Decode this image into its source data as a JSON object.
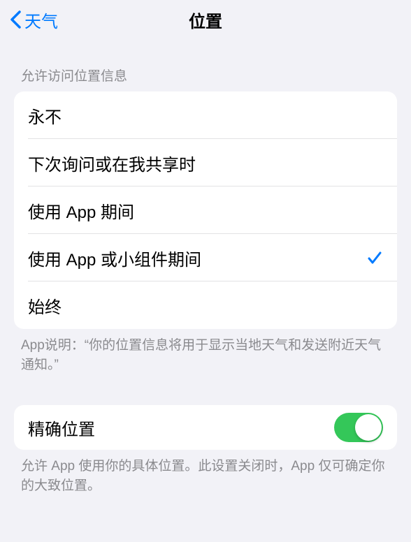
{
  "nav": {
    "back_label": "天气",
    "title": "位置"
  },
  "section1": {
    "header": "允许访问位置信息",
    "options": [
      {
        "label": "永不",
        "selected": false
      },
      {
        "label": "下次询问或在我共享时",
        "selected": false
      },
      {
        "label": "使用 App 期间",
        "selected": false
      },
      {
        "label": "使用 App 或小组件期间",
        "selected": true
      },
      {
        "label": "始终",
        "selected": false
      }
    ],
    "footer": "App说明：“你的位置信息将用于显示当地天气和发送附近天气通知。”"
  },
  "section2": {
    "toggle_label": "精确位置",
    "toggle_on": true,
    "footer": "允许 App 使用你的具体位置。此设置关闭时，App 仅可确定你的大致位置。"
  }
}
